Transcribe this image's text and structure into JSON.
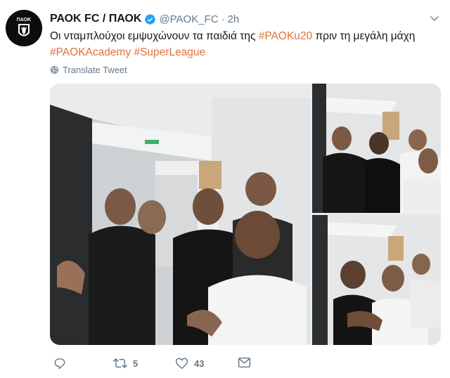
{
  "tweet": {
    "author": {
      "display_name": "ΡΑΟΚ FC / ΠΑΟΚ",
      "handle": "@PAOK_FC",
      "verified": true,
      "avatar_icon": "paok-eagle-crest-icon"
    },
    "separator": "·",
    "time": "2h",
    "text": {
      "part1": "Οι νταμπλούχοι εμψυχώνουν τα παιδιά της ",
      "hashtag1": "#PAOKu20",
      "part2": " πριν τη μεγάλη μάχη",
      "hashtag2": "#PAOKAcademy",
      "hashtag3": "#SuperLeague"
    },
    "translate_label": "Translate Tweet",
    "menu_icon": "chevron-down-icon",
    "media": [
      {
        "name": "photo-main",
        "description_icon": "locker-room-corridor-photo"
      },
      {
        "name": "photo-top",
        "description_icon": "players-greeting-photo"
      },
      {
        "name": "photo-bottom",
        "description_icon": "players-hugging-photo"
      }
    ],
    "actions": {
      "reply_icon": "reply-icon",
      "reply_count": "",
      "retweet_icon": "retweet-icon",
      "retweet_count": "5",
      "like_icon": "heart-icon",
      "like_count": "43",
      "dm_icon": "envelope-icon"
    },
    "colors": {
      "hashtag": "#e0713b",
      "secondary": "#657786",
      "verified": "#1da1f2",
      "text": "#14171a"
    }
  }
}
